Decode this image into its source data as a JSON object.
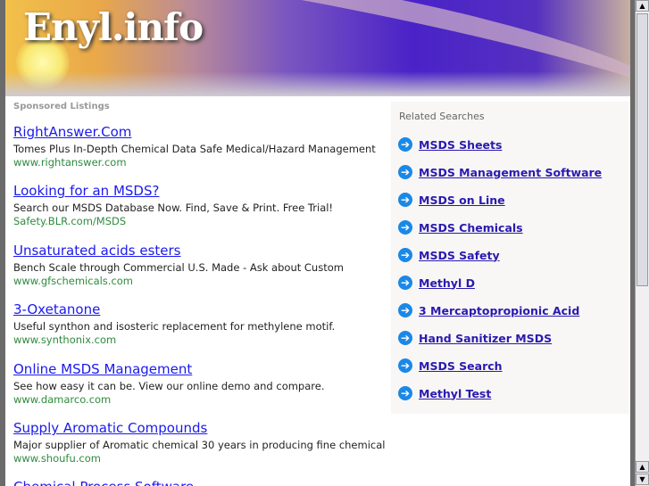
{
  "header": {
    "logo": "Enyl.info"
  },
  "sponsored": {
    "label": "Sponsored Listings",
    "listings": [
      {
        "title": "RightAnswer.Com",
        "desc": "Tomes Plus In-Depth Chemical Data Safe Medical/Hazard Management",
        "url": "www.rightanswer.com"
      },
      {
        "title": "Looking for an MSDS?",
        "desc": "Search our MSDS Database Now. Find, Save & Print. Free Trial!",
        "url": "Safety.BLR.com/MSDS"
      },
      {
        "title": "Unsaturated acids esters",
        "desc": "Bench Scale through Commercial U.S. Made - Ask about Custom",
        "url": "www.gfschemicals.com"
      },
      {
        "title": "3-Oxetanone",
        "desc": "Useful synthon and isosteric replacement for methylene motif.",
        "url": "www.synthonix.com"
      },
      {
        "title": "Online MSDS Management",
        "desc": "See how easy it can be. View our online demo and compare.",
        "url": "www.damarco.com"
      },
      {
        "title": "Supply Aromatic Compounds",
        "desc": "Major supplier of Aromatic chemical 30 years in producing fine chemical",
        "url": "www.shoufu.com"
      },
      {
        "title": "Chemical Process Software",
        "desc": "",
        "url": ""
      }
    ]
  },
  "related": {
    "label": "Related Searches",
    "items": [
      "MSDS Sheets",
      "MSDS Management Software",
      "MSDS on Line",
      "MSDS Chemicals",
      "MSDS Safety",
      "Methyl D",
      "3 Mercaptopropionic Acid",
      "Hand Sanitizer MSDS",
      "MSDS Search",
      "Methyl Test"
    ]
  },
  "scrollbar": {
    "up": "▲",
    "down": "▼"
  }
}
